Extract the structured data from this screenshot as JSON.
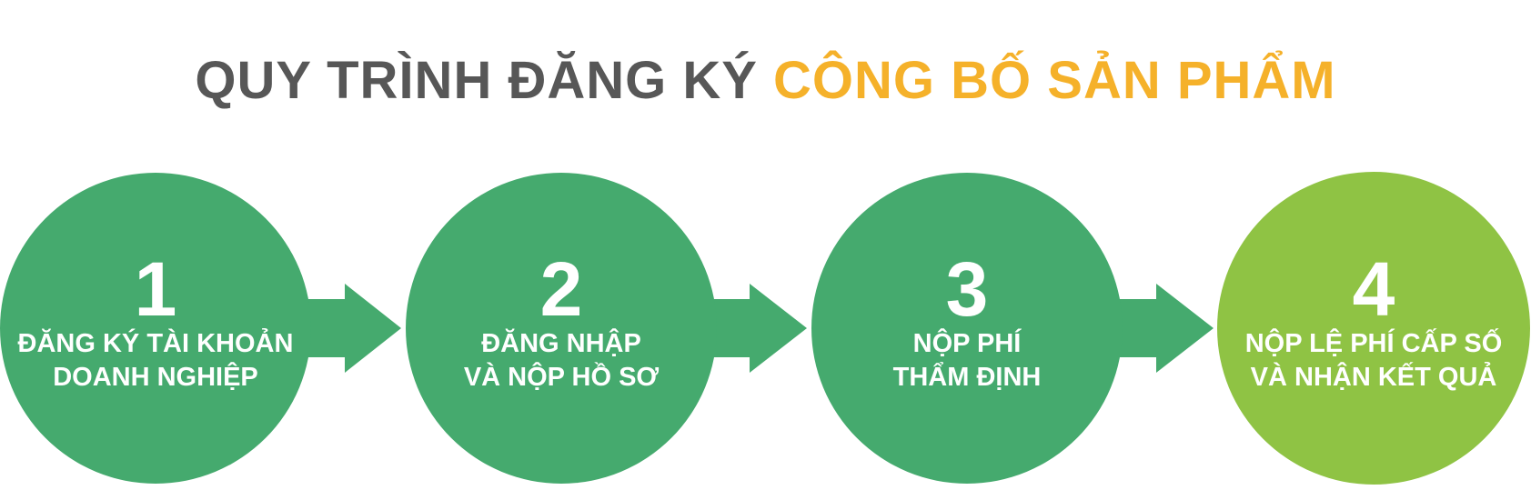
{
  "title": {
    "part1": "QUY TRÌNH ĐĂNG KÝ",
    "part2": "CÔNG BỐ SẢN PHẨM"
  },
  "colors": {
    "title_dark": "#575757",
    "title_accent": "#f5b12a",
    "step_green": "#45aa6e",
    "step_final": "#8fc344",
    "arrow": "#45aa6e"
  },
  "steps": [
    {
      "number": "1",
      "line1": "ĐĂNG KÝ TÀI KHOẢN",
      "line2": "DOANH NGHIỆP"
    },
    {
      "number": "2",
      "line1": "ĐĂNG NHẬP",
      "line2": "VÀ NỘP HỒ SƠ"
    },
    {
      "number": "3",
      "line1": "NỘP PHÍ",
      "line2": "THẨM ĐỊNH"
    },
    {
      "number": "4",
      "line1": "NỘP LỆ PHÍ CẤP SỐ",
      "line2": "VÀ NHẬN KẾT QUẢ"
    }
  ]
}
